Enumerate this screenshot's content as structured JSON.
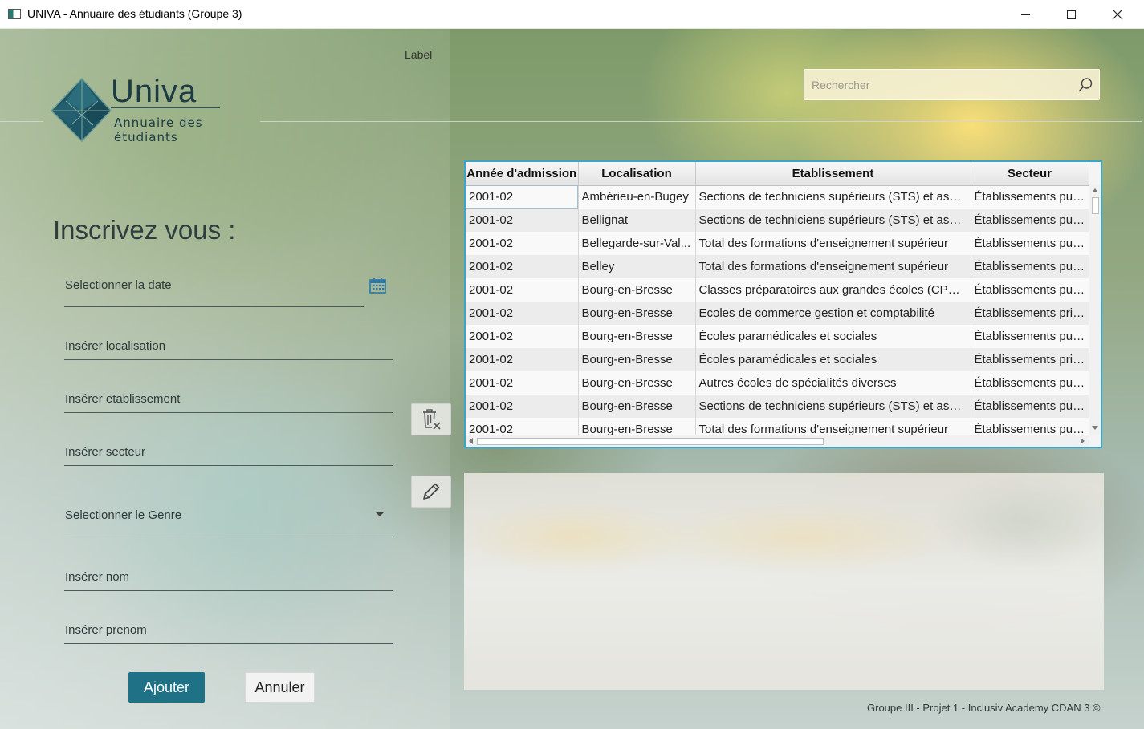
{
  "window": {
    "title": "UNIVA - Annuaire des étudiants (Groupe 3)",
    "controls": [
      "minimize",
      "maximize",
      "close"
    ]
  },
  "header": {
    "label": "Label",
    "brand": "Univa",
    "subtitle": "Annuaire des étudiants",
    "search": {
      "placeholder": "Rechercher",
      "value": ""
    }
  },
  "form": {
    "title": "Inscrivez vous :",
    "fields": {
      "date": "Selectionner la date",
      "localisation": "Insérer localisation",
      "etablissement": "Insérer etablissement",
      "secteur": "Insérer secteur",
      "genre": "Selectionner le Genre",
      "nom": "Insérer nom",
      "prenom": "Insérer prenom"
    },
    "submit_label": "Ajouter",
    "cancel_label": "Annuler"
  },
  "actions": {
    "delete_icon": "trash-x-icon",
    "edit_icon": "pencil-icon"
  },
  "table": {
    "columns": [
      "Année d'admission",
      "Localisation",
      "Etablissement",
      "Secteur"
    ],
    "rows": [
      [
        "2001-02",
        "Ambérieu-en-Bugey",
        "Sections de techniciens supérieurs (STS) et assim...",
        "Établissements pub..."
      ],
      [
        "2001-02",
        "Bellignat",
        "Sections de techniciens supérieurs (STS) et assim...",
        "Établissements pub..."
      ],
      [
        "2001-02",
        "Bellegarde-sur-Val...",
        "Total des formations d'enseignement supérieur",
        "Établissements pub..."
      ],
      [
        "2001-02",
        "Belley",
        "Total des formations d'enseignement supérieur",
        "Établissements pub..."
      ],
      [
        "2001-02",
        "Bourg-en-Bresse",
        "Classes préparatoires aux grandes écoles (CPGE)",
        "Établissements pub..."
      ],
      [
        "2001-02",
        "Bourg-en-Bresse",
        "Ecoles de commerce gestion et comptabilité",
        "Établissements privés"
      ],
      [
        "2001-02",
        "Bourg-en-Bresse",
        "Écoles paramédicales et sociales",
        "Établissements pub..."
      ],
      [
        "2001-02",
        "Bourg-en-Bresse",
        "Écoles paramédicales et sociales",
        "Établissements privés"
      ],
      [
        "2001-02",
        "Bourg-en-Bresse",
        "Autres écoles de spécialités diverses",
        "Établissements pub..."
      ],
      [
        "2001-02",
        "Bourg-en-Bresse",
        "Sections de techniciens supérieurs (STS) et assim...",
        "Établissements pub..."
      ],
      [
        "2001-02",
        "Bourg-en-Bresse",
        "Total des formations d'enseignement supérieur",
        "Établissements pub..."
      ]
    ]
  },
  "footer": "Groupe III - Projet 1 - Inclusiv Academy CDAN 3 ©",
  "colors": {
    "accent": "#1f7185",
    "table_border": "#3aa5c9",
    "calendar_icon": "#2a78a8"
  }
}
